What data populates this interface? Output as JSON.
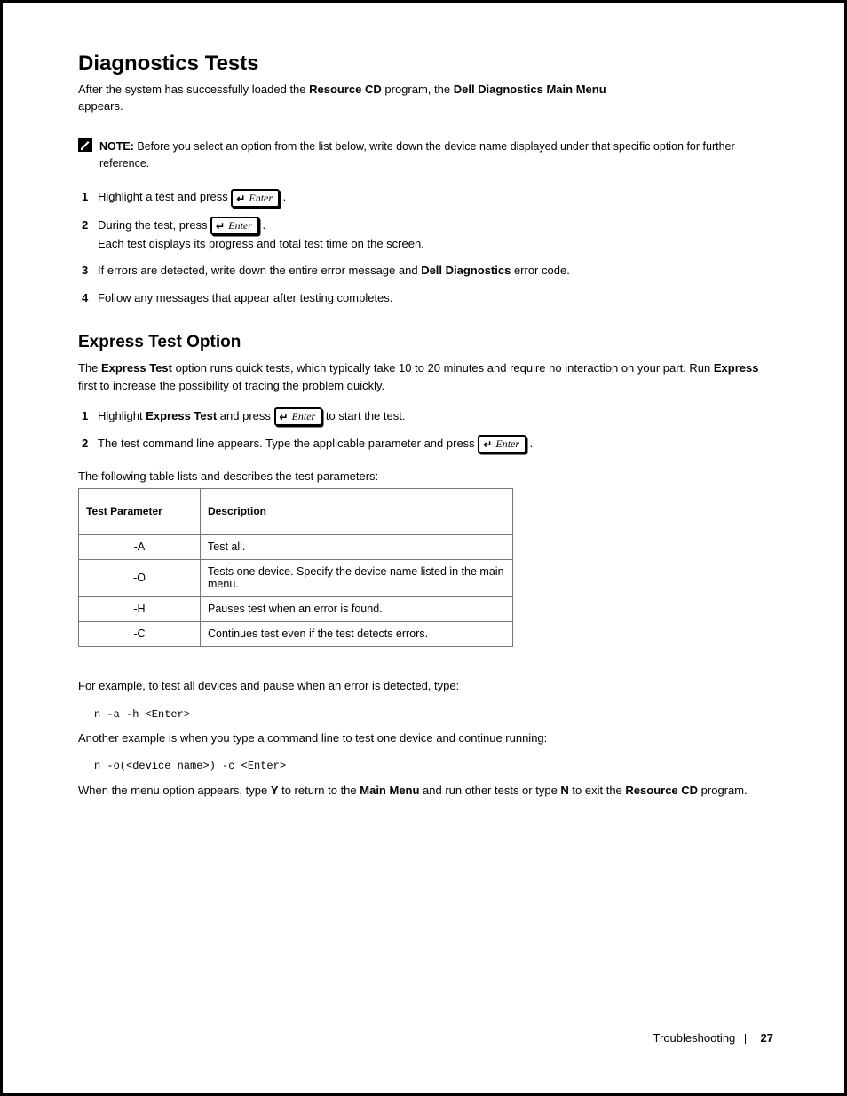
{
  "h1": "Diagnostics Tests",
  "sub_line1": "After the system has successfully loaded the ",
  "sub_line1_b": "Resource CD",
  "sub_line1_end": " program, the ",
  "sub_line1_b2": "Dell Diagnostics Main Menu",
  "sub_line1_tail": " appears.",
  "note_label": "NOTE: ",
  "note_body": "Before you select an option from the list below, write down the device name displayed under that specific option for further reference.",
  "step1_a": "Highlight a test and press ",
  "step1_b": ".",
  "step2_a": "During the test, press ",
  "step2_b": ".",
  "step2_c": "Each test displays its progress and total test time on the screen.",
  "step3_a": "If errors are detected, write down the entire error message and ",
  "step3_b": "Dell Diagnostics",
  "step3_c": " error code.",
  "step4": "Follow any messages that appear after testing completes.",
  "h2": "Express Test Option",
  "intro_a": "The ",
  "intro_b": "Express Test",
  "intro_c": " option runs quick tests, which typically take 10 to 20 minutes and require no interaction on your part. Run ",
  "intro_d": "Express",
  "intro_e": " first to increase the possibility of tracing the problem quickly.",
  "s2_1_a": "Highlight ",
  "s2_1_b": "Express Test",
  "s2_1_c": " and press ",
  "s2_1_d": " to start the test.",
  "s2_2_a": "The test command line appears. Type the applicable parameter and press ",
  "s2_2_b": ".",
  "caption": "The following table lists and describes the test parameters:",
  "th1": "Test Parameter",
  "th2": "Description",
  "rows": [
    {
      "p": "-A",
      "d": "Test all."
    },
    {
      "p": "-O",
      "d": "Tests one device. Specify the device name listed in the main menu."
    },
    {
      "p": "-H",
      "d": "Pauses test when an error is found."
    },
    {
      "p": "-C",
      "d": "Continues test even if the test detects errors."
    }
  ],
  "close1": "For example, to test all devices and pause when an error is detected, type:",
  "code1": "n -a -h <Enter>",
  "close2": "Another example is when you type a command line to test one device and continue running:",
  "code2": "n -o(<device name>) -c <Enter>",
  "close3_a": "When the menu option appears, type ",
  "close3_b": "Y",
  "close3_c": " to return to the ",
  "close3_d": "Main Menu",
  "close3_e": " and run other tests or type ",
  "close3_f": "N",
  "close3_g": " to exit the ",
  "close3_h": "Resource CD",
  "close3_i": " program.",
  "footer_text": "Troubleshooting",
  "footer_page": "27",
  "enter_label": "Enter"
}
